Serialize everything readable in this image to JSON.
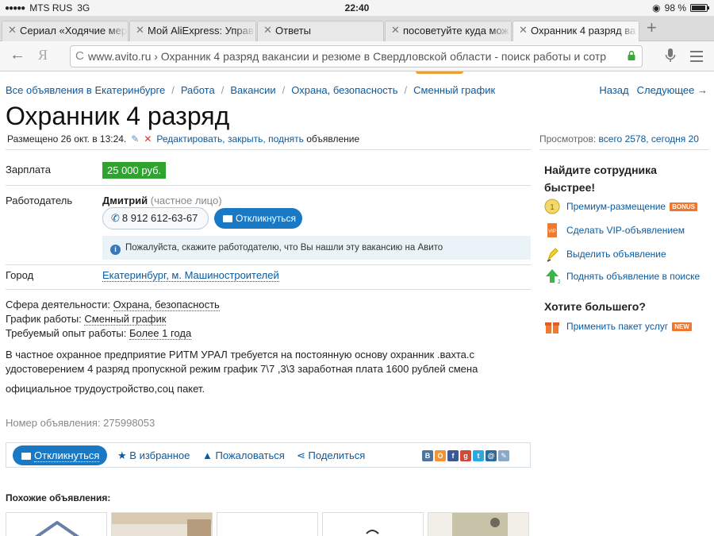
{
  "status": {
    "carrier": "MTS RUS",
    "network": "3G",
    "time": "22:40",
    "battery": "98 %"
  },
  "tabs": [
    {
      "label": "Сериал «Ходячие мер"
    },
    {
      "label": "Мой AliExpress: Управ"
    },
    {
      "label": "Ответы"
    },
    {
      "label": "посоветуйте куда мож"
    },
    {
      "label": "Охранник 4 разряд ва"
    }
  ],
  "address": {
    "url": "www.avito.ru › Охранник 4 разряд вакансии и резюме в Свердловской области - поиск работы и сотр",
    "search_logo": "Я"
  },
  "breadcrumb": {
    "items": [
      "Все объявления в Екатеринбурге",
      "Работа",
      "Вакансии",
      "Охрана, безопасность",
      "Сменный график"
    ],
    "separator": "/",
    "back": "Назад",
    "next": "Следующее →"
  },
  "listing": {
    "title": "Охранник 4 разряд",
    "posted": "Размещено 26 окт. в 13:24.",
    "edit_link": "Редактировать, закрыть, поднять",
    "edit_suffix": "объявление",
    "views_label": "Просмотров:",
    "views_value": "всего 2578, сегодня 20",
    "salary_label": "Зарплата",
    "salary": "25 000 руб.",
    "employer_label": "Работодатель",
    "employer_name": "Дмитрий",
    "employer_type": "(частное лицо)",
    "phone": "8 912 612-63-67",
    "reply_button": "Откликнуться",
    "notice": "Пожалуйста, скажите работодателю, что Вы нашли эту вакансию на Авито",
    "city_label": "Город",
    "city": "Екатеринбург, м. Машиностроителей",
    "sphere_label": "Сфера деятельности:",
    "sphere": "Охрана, безопасность",
    "schedule_label": "График работы:",
    "schedule": "Сменный график",
    "experience_label": "Требуемый опыт работы:",
    "experience": "Более 1 года",
    "description_line1": "В частное охранное предприятие РИТМ УРАЛ требуется на постоянную основу охранник .вахта.с удостоверением 4 разряд пропускной режим график 7\\7 ,3\\3 заработная плата 1600 рублей смена",
    "description_line2": "официальное трудоустройство,соц пакет.",
    "ad_number": "Номер объявления: 275998053"
  },
  "actions": {
    "reply": "Откликнуться",
    "favorite": "В избранное",
    "complain": "Пожаловаться",
    "share": "Поделиться",
    "social_icons": [
      "vk-icon",
      "odnoklassniki-icon",
      "facebook-icon",
      "googleplus-icon",
      "twitter-icon",
      "mailru-icon",
      "livejournal-icon"
    ]
  },
  "similar": {
    "heading": "Похожие объявления:"
  },
  "sidebar": {
    "heading1": "Найдите сотрудника быстрее!",
    "items": [
      {
        "label": "Премиум-размещение",
        "badge": "BONUS"
      },
      {
        "label": "Сделать VIP-объявлением"
      },
      {
        "label": "Выделить объявление"
      },
      {
        "label": "Поднять объявление в поиске"
      }
    ],
    "heading2": "Хотите большего?",
    "package": {
      "label": "Применить пакет услуг",
      "badge": "NEW"
    }
  },
  "colors": {
    "link": "#0a5ba0",
    "salary_bg": "#2ea32e",
    "button": "#1a79c4",
    "badge": "#f0762d"
  }
}
